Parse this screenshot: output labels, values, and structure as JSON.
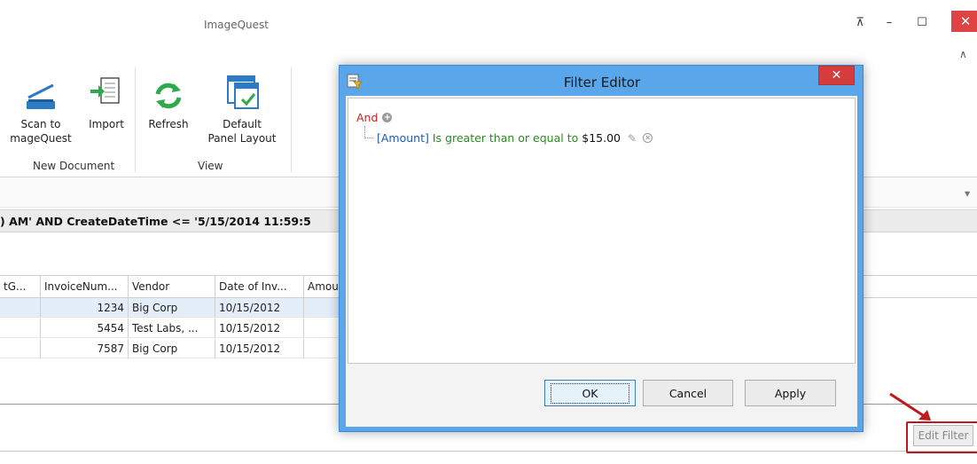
{
  "window": {
    "title": "ImageQuest",
    "pin_glyph": "⊼",
    "min_glyph": "–",
    "max_glyph": "☐",
    "close_glyph": "✕",
    "collapse_glyph": "∧"
  },
  "ribbon": {
    "groups": [
      {
        "label": "New Document"
      },
      {
        "label": "View"
      }
    ],
    "buttons": {
      "scan_line1": "Scan to",
      "scan_line2": "mageQuest",
      "import": "Import",
      "refresh": "Refresh",
      "default_layout_line1": "Default",
      "default_layout_line2": "Panel Layout"
    }
  },
  "filter_bar": {
    "sql_text": ") AM' AND CreateDateTime <= '5/15/2014 11:59:5",
    "dropdown_glyph": "▼"
  },
  "grid": {
    "headers": [
      "tG...",
      "InvoiceNum...",
      "Vendor",
      "Date of Inv...",
      "Amou"
    ],
    "rows": [
      {
        "invoice": "1234",
        "vendor": "Big Corp",
        "date": "10/15/2012"
      },
      {
        "invoice": "5454",
        "vendor": "Test Labs, ...",
        "date": "10/15/2012"
      },
      {
        "invoice": "7587",
        "vendor": "Big Corp",
        "date": "10/15/2012"
      }
    ],
    "selected_row": 0
  },
  "edit_filter_button": {
    "label": "Edit Filter"
  },
  "dialog": {
    "title": "Filter Editor",
    "close_glyph": "✕",
    "root": {
      "operator": "And",
      "add_glyph": "+"
    },
    "condition": {
      "field": "[Amount]",
      "operator": "Is greater than or equal to",
      "value": "$15.00",
      "edit_glyph": "✎",
      "remove_glyph": "✕"
    },
    "buttons": {
      "ok": "OK",
      "cancel": "Cancel",
      "apply": "Apply"
    }
  },
  "colors": {
    "dialog_frame": "#5aa6ea",
    "close_red": "#e04343",
    "and_red": "#cc1f1f",
    "field_blue": "#1d5bbd",
    "operator_green": "#2a8a21",
    "selected_row": "#e3eef9",
    "callout_red": "#c0191d"
  },
  "icons": {
    "scan": "scanner-icon",
    "import": "import-document-icon",
    "refresh": "refresh-icon",
    "layout": "panel-layout-icon",
    "dialog": "filter-editor-icon"
  }
}
